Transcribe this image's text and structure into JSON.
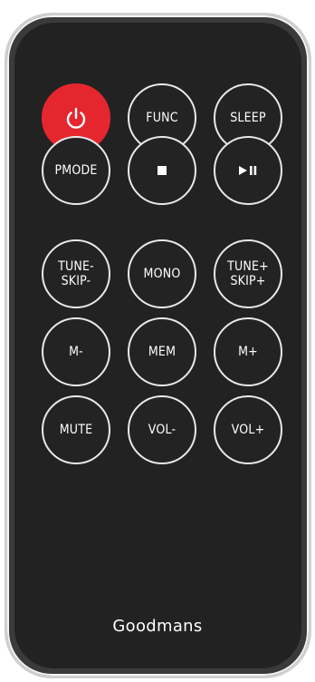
{
  "brand": "Goodmans",
  "buttons": {
    "power": {
      "icon": "power-icon"
    },
    "func": {
      "label": "FUNC"
    },
    "sleep": {
      "label": "SLEEP"
    },
    "pmode": {
      "label": "PMODE"
    },
    "stop": {
      "icon": "stop-icon"
    },
    "play_pause": {
      "icon": "play-pause-icon"
    },
    "tune_skip_minus": {
      "line1": "TUNE-",
      "line2": "SKIP-"
    },
    "mono": {
      "label": "MONO"
    },
    "tune_skip_plus": {
      "line1": "TUNE+",
      "line2": "SKIP+"
    },
    "m_minus": {
      "label": "M-"
    },
    "mem": {
      "label": "MEM"
    },
    "m_plus": {
      "label": "M+"
    },
    "mute": {
      "label": "MUTE"
    },
    "vol_minus": {
      "label": "VOL-"
    },
    "vol_plus": {
      "label": "VOL+"
    }
  },
  "colors": {
    "power_button": "#e6262f",
    "body": "#222222",
    "button_ring": "#e9e9e9"
  }
}
